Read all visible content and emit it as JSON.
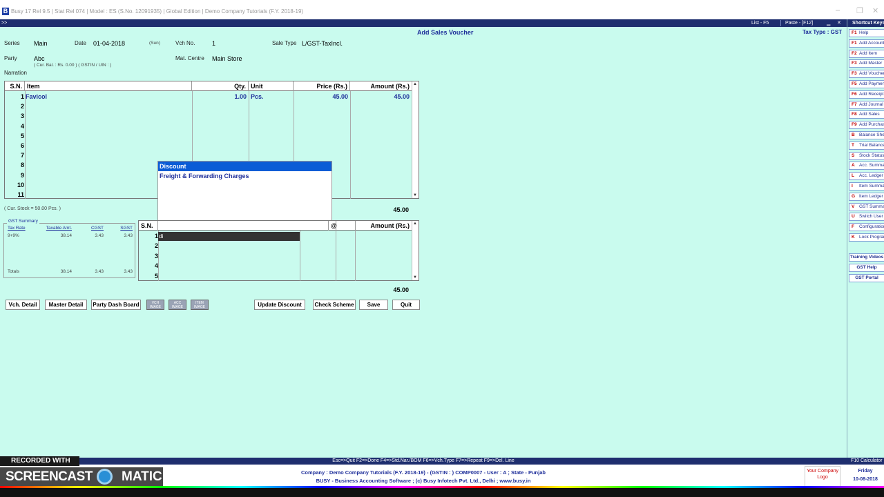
{
  "window": {
    "app_icon": "B",
    "title": "Busy 17  Rel 9.5  |  Stat Rel 074  |  Model : ES (S.No. 12091935)  |  Global Edition  |  Demo Company Tutorials (F.Y. 2018-19)"
  },
  "toolbar": {
    "arrow": ">>",
    "list": "List - F5",
    "paste": "Paste - [F12]"
  },
  "form": {
    "title": "Add Sales Voucher",
    "tax_type": "Tax Type : GST",
    "series_label": "Series",
    "series_value": "Main",
    "date_label": "Date",
    "date_value": "01-04-2018",
    "day_value": "(Sun)",
    "vch_label": "Vch No.",
    "vch_value": "1",
    "saletype_label": "Sale Type",
    "saletype_value": "L/GST-TaxIncl.",
    "party_label": "Party",
    "party_value": "Abc",
    "party_sub": "( Cur. Bal. : Rs. 0.00   ) ( GSTIN / UIN : )",
    "matcentre_label": "Mat. Centre",
    "matcentre_value": "Main Store",
    "narration_label": "Narration"
  },
  "items_table": {
    "headers": {
      "sn": "S.N.",
      "item": "Item",
      "qty": "Qty.",
      "unit": "Unit",
      "price": "Price (Rs.)",
      "amount": "Amount (Rs.)"
    },
    "rows": [
      {
        "sn": "1",
        "item": "Favicol",
        "qty": "1.00",
        "unit": "Pcs.",
        "price": "45.00",
        "amount": "45.00"
      },
      {
        "sn": "2"
      },
      {
        "sn": "3"
      },
      {
        "sn": "4"
      },
      {
        "sn": "5"
      },
      {
        "sn": "6"
      },
      {
        "sn": "7"
      },
      {
        "sn": "8"
      },
      {
        "sn": "9"
      },
      {
        "sn": "10"
      },
      {
        "sn": "11"
      }
    ],
    "cur_stock": "( Cur. Stock = 50.00  Pcs. )",
    "total": "45.00"
  },
  "popup": {
    "items": [
      "Discount",
      "Freight & Forwarding Charges"
    ]
  },
  "gst_summary": {
    "title": "GST Summary",
    "headers": [
      "Tax Rate",
      "Taxable Amt.",
      "CGST",
      "SGST"
    ],
    "row": [
      "9+9%",
      "38.14",
      "3.43",
      "3.43"
    ],
    "totals_label": "Totals",
    "totals": [
      "38.14",
      "3.43",
      "3.43"
    ]
  },
  "bs_table": {
    "sn_header": "S.N.",
    "col_fragment": "@",
    "amount_header": "Amount (Rs.)",
    "input_value": "di",
    "rows": [
      "1",
      "2",
      "3",
      "4",
      "5"
    ],
    "total": "45.00"
  },
  "buttons": {
    "vch_detail": "Vch. Detail",
    "master_detail": "Master Detail",
    "party_dash": "Party Dash Board",
    "vch_image": "VCH IMAGE",
    "acc_image": "ACC IMAGE",
    "item_image": "ITEM IMAGE",
    "update_discount": "Update Discount",
    "check_scheme": "Check Scheme",
    "save": "Save",
    "quit": "Quit"
  },
  "shortcuts": {
    "header": "Shortcut Keys",
    "items": [
      {
        "key": "F1",
        "label": "Help"
      },
      {
        "key": "F1",
        "label": "Add Account"
      },
      {
        "key": "F2",
        "label": "Add Item"
      },
      {
        "key": "F3",
        "label": "Add Master"
      },
      {
        "key": "F3",
        "label": "Add Voucher"
      },
      {
        "key": "F5",
        "label": "Add Payment"
      },
      {
        "key": "F6",
        "label": "Add Receipt"
      },
      {
        "key": "F7",
        "label": "Add Journal"
      },
      {
        "key": "F8",
        "label": "Add Sales"
      },
      {
        "key": "F9",
        "label": "Add Purchase"
      },
      {
        "key": "B",
        "label": "Balance Sheet"
      },
      {
        "key": "T",
        "label": "Trial Balance"
      },
      {
        "key": "S",
        "label": "Stock Status"
      },
      {
        "key": "A",
        "label": "Acc. Summary"
      },
      {
        "key": "L",
        "label": "Acc. Ledger"
      },
      {
        "key": "I",
        "label": "Item Summary"
      },
      {
        "key": "G",
        "label": "Item Ledger"
      },
      {
        "key": "V",
        "label": "GST Summary"
      },
      {
        "key": "U",
        "label": "Switch User"
      },
      {
        "key": "F",
        "label": "Configuration"
      },
      {
        "key": "K",
        "label": "Lock Program"
      }
    ],
    "extra": [
      "Training Videos",
      "GST Help",
      "GST Portal"
    ]
  },
  "status": {
    "keys": "Esc=>Quit  F2=>Done  F4=>Std.Nar./BOM  F6=>Vch.Type  F7=>Repeat  F9=>Del. Line",
    "right": "F10 Calculator"
  },
  "footer": {
    "line1": "Company : Demo Company Tutorials (F.Y. 2018-19) - (GSTIN : ) COMP0007 - User : A ; State - Punjab",
    "line2": "BUSY - Business Accounting Software  ;  (c) Busy Infotech Pvt. Ltd., Delhi  ;  www.busy.in",
    "logo": "Your Company Logo",
    "day": "Friday",
    "date": "10-08-2018"
  },
  "watermark": {
    "recorded": "RECORDED WITH",
    "brand_left": "SCREENCAST",
    "brand_right": "MATIC"
  },
  "colors": {
    "background": "#c9fbee",
    "bar": "#1e2e6e",
    "highlight": "#0a5cd6"
  }
}
